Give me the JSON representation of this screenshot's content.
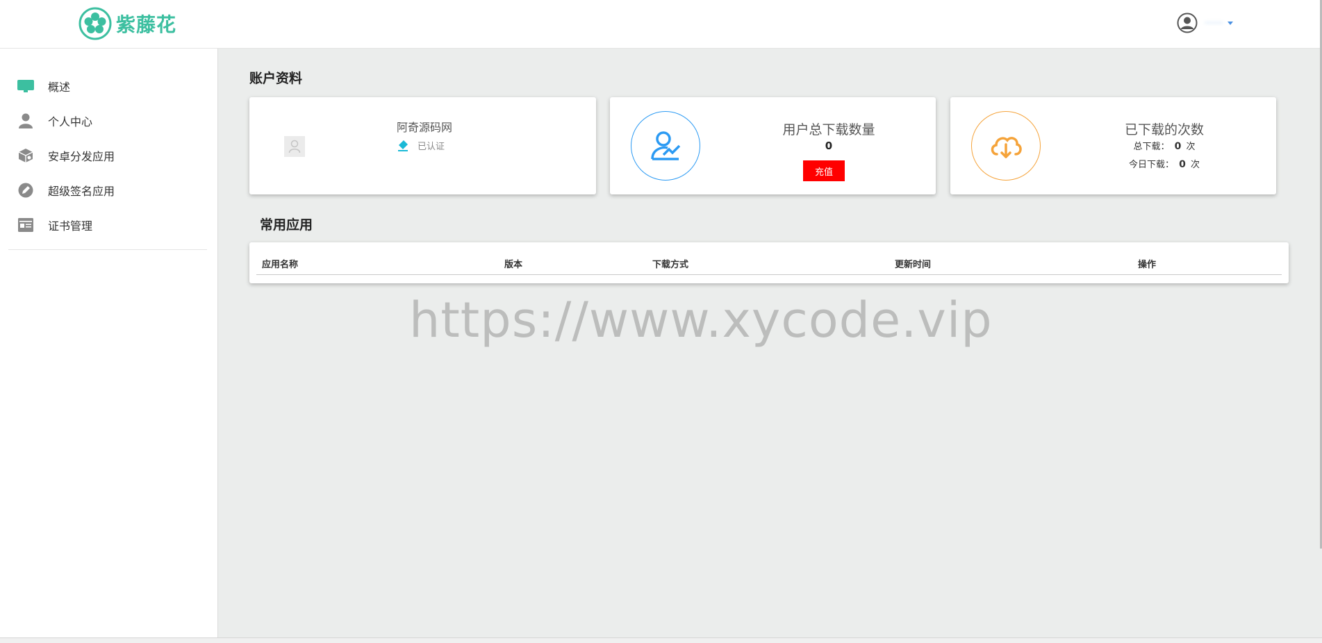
{
  "header": {
    "brand": "紫藤花",
    "user_name": "·······"
  },
  "sidebar": {
    "items": [
      {
        "label": "概述",
        "icon": "monitor-icon"
      },
      {
        "label": "个人中心",
        "icon": "user-icon"
      },
      {
        "label": "安卓分发应用",
        "icon": "package-icon"
      },
      {
        "label": "超级签名应用",
        "icon": "pen-icon"
      },
      {
        "label": "证书管理",
        "icon": "id-card-icon"
      }
    ]
  },
  "account": {
    "section_title": "账户资料",
    "profile": {
      "name": "阿奇源码网",
      "verified_label": "已认证"
    },
    "downloads_card": {
      "title": "用户总下载数量",
      "value": "0",
      "recharge_label": "充值"
    },
    "count_card": {
      "title": "已下载的次数",
      "total_label": "总下载：",
      "total_value": "0",
      "today_label": "今日下载：",
      "today_value": "0",
      "unit": "次"
    }
  },
  "apps": {
    "section_title": "常用应用",
    "columns": [
      "应用名称",
      "版本",
      "下载方式",
      "更新时间",
      "操作"
    ]
  },
  "watermark": "https://www.xycode.vip",
  "colors": {
    "brand": "#3cbfa0",
    "recharge": "#ff0000",
    "blue_ring": "#2b9af3",
    "orange_ring": "#f5a33a"
  }
}
